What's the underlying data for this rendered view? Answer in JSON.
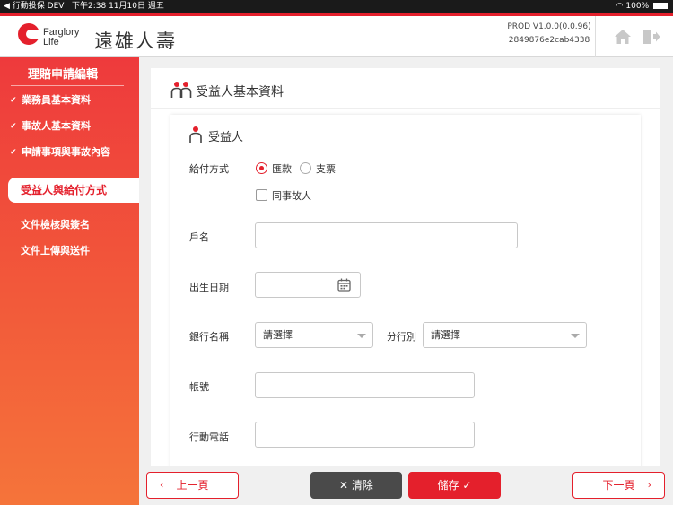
{
  "status_bar": {
    "carrier": "◀ 行動投保 DEV",
    "datetime": "下午2:38   11月10日 週五",
    "battery": "100%"
  },
  "header": {
    "logo_en_line1": "Farglory",
    "logo_en_line2": "Life",
    "logo_zh": "遠雄人壽",
    "version": "PROD V1.0.0(0.0.96)",
    "build_hash": "2849876e2cab4338",
    "home_icon": "home-icon",
    "logout_icon": "logout-icon"
  },
  "sidebar": {
    "title": "理賠申請編輯",
    "completed_items": [
      {
        "label": "業務員基本資料"
      },
      {
        "label": "事故人基本資料"
      },
      {
        "label": "申請事項與事故內容"
      }
    ],
    "active_item": "受益人與給付方式",
    "pending_items": [
      {
        "label": "文件檢核與簽名"
      },
      {
        "label": "文件上傳與送件"
      }
    ]
  },
  "section": {
    "title": "受益人基本資料"
  },
  "card": {
    "title": "受益人",
    "payment_label": "給付方式",
    "payment_options": [
      {
        "label": "匯款",
        "selected": true
      },
      {
        "label": "支票",
        "selected": false
      }
    ],
    "same_as_insured_label": "同事故人",
    "same_as_insured_checked": false,
    "account_name_label": "戶名",
    "account_name_value": "",
    "birthdate_label": "出生日期",
    "birthdate_value": "",
    "bank_label": "銀行名稱",
    "bank_value": "請選擇",
    "branch_label": "分行別",
    "branch_value": "請選擇",
    "account_no_label": "帳號",
    "account_no_value": "",
    "mobile_label": "行動電話",
    "mobile_value": ""
  },
  "footer": {
    "prev_label": "上一頁",
    "clear_label": "清除",
    "save_label": "儲存",
    "next_label": "下一頁"
  },
  "colors": {
    "brand_red": "#e4202c",
    "dark_button": "#4a4a4a"
  }
}
